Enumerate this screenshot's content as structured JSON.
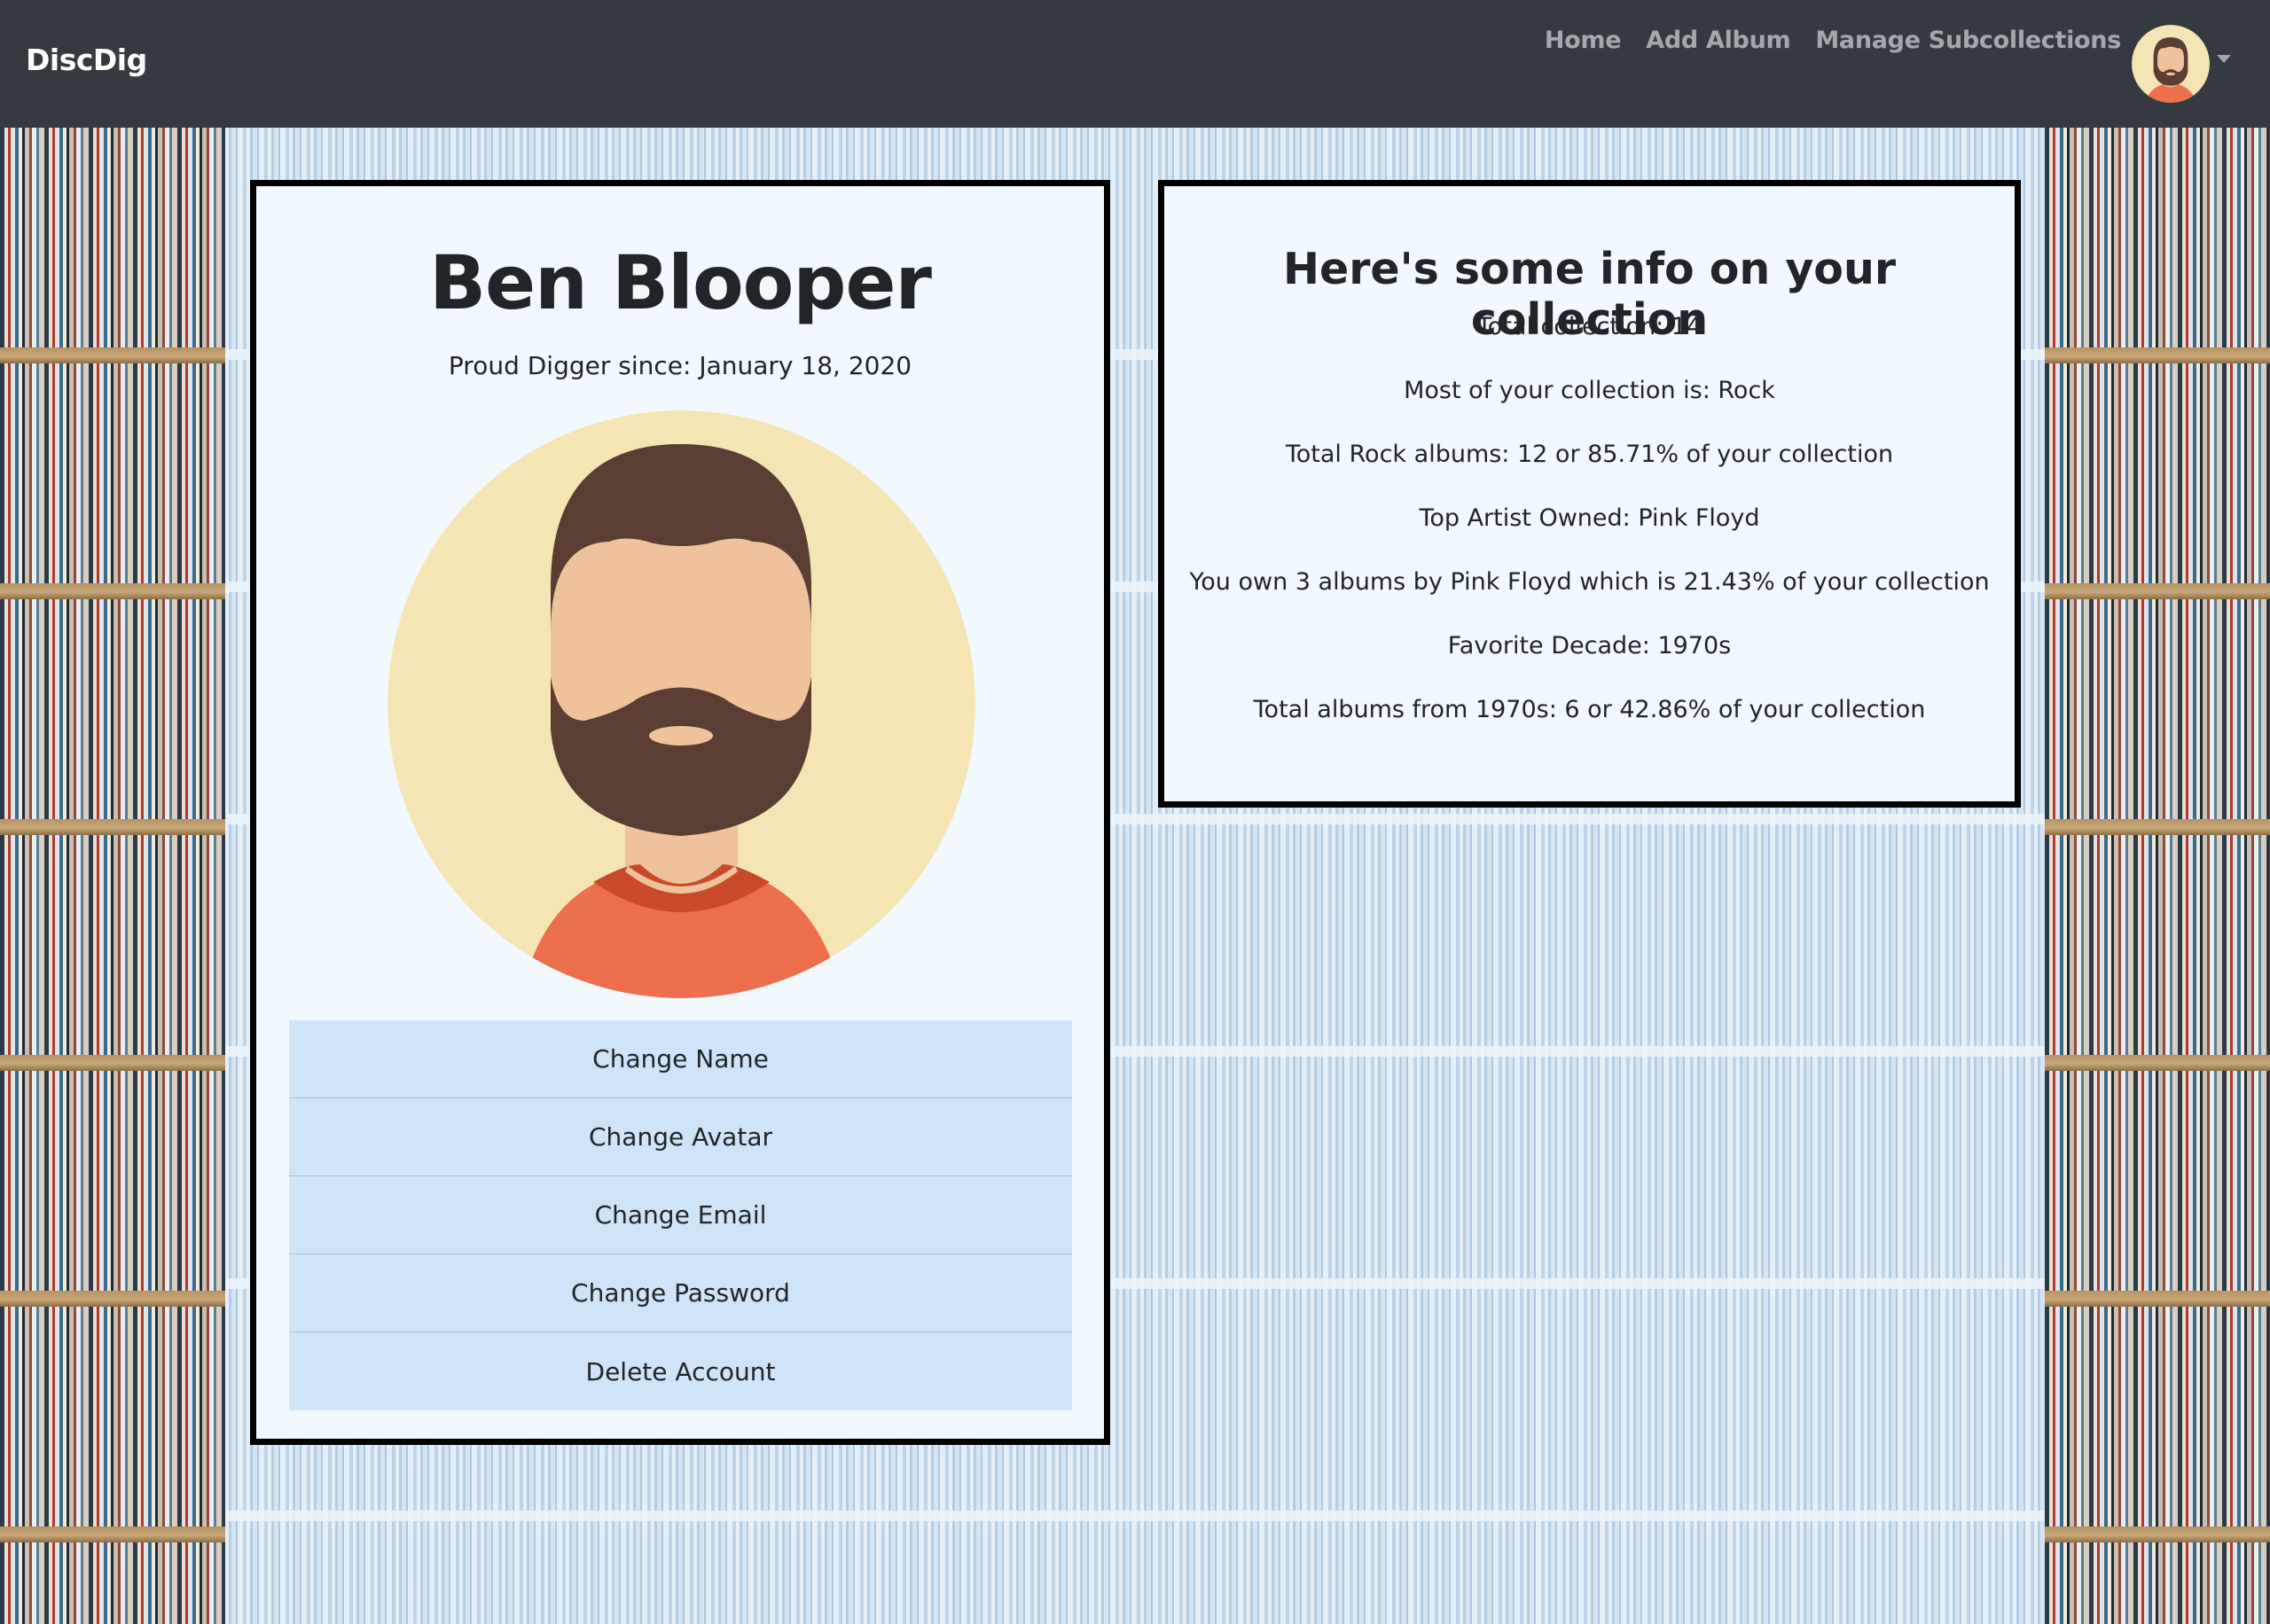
{
  "navbar": {
    "brand": "DiscDig",
    "links": [
      "Home",
      "Add Album",
      "Manage Subcollections"
    ],
    "avatar_icon": "bearded-man-avatar-icon",
    "dropdown_icon": "caret-down-icon"
  },
  "profile": {
    "name": "Ben Blooper",
    "member_since": "Proud Digger since: January 18, 2020",
    "avatar_icon": "bearded-man-avatar-icon",
    "actions": [
      "Change Name",
      "Change Avatar",
      "Change Email",
      "Change Password",
      "Delete Account"
    ]
  },
  "stats": {
    "title": "Here's some info on your collection",
    "lines": [
      "Total collection: 14",
      "Most of your collection is: Rock",
      "Total Rock albums: 12 or 85.71% of your collection",
      "Top Artist Owned: Pink Floyd",
      "You own 3 albums by Pink Floyd which is 21.43% of your collection",
      "Favorite Decade: 1970s",
      "Total albums from 1970s: 6 or 42.86% of your collection"
    ]
  },
  "colors": {
    "navbar_bg": "#343a40",
    "card_bg": "#f1f8fe",
    "list_button_bg": "#cfe3f9",
    "avatar_bg": "#f5e4b4",
    "beard": "#5a3d33",
    "skin": "#eec39b",
    "shirt": "#ec6f4e"
  }
}
